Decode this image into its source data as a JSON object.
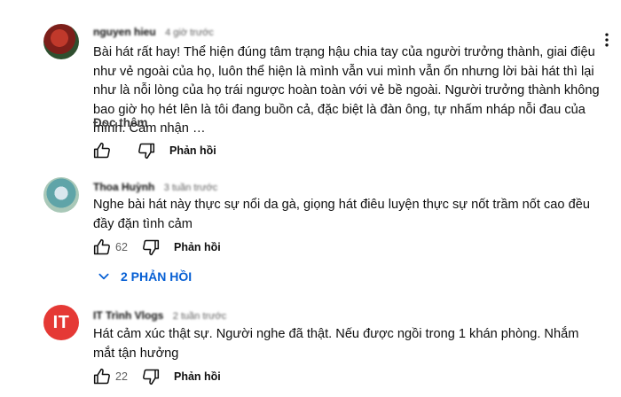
{
  "comments": [
    {
      "author": "nguyen hieu",
      "time": "4 giờ trước",
      "avatar_type": "photo",
      "text": "Bài hát rất hay! Thể hiện đúng tâm trạng hậu chia tay của người trưởng thành, giai điệu như vẻ ngoài của họ, luôn thể hiện là mình vẫn vui mình vẫn ổn nhưng lời bài hát thì lại như là nỗi lòng của họ trái ngược hoàn toàn với vẻ bề ngoài. Người trưởng thành không bao giờ họ hét lên là tôi đang buồn cả, đặc biệt là đàn ông, tự nhấm nháp nỗi đau của mình. Cảm nhận …",
      "read_more": "Đọc thêm",
      "like_count": "",
      "reply_label": "Phản hồi"
    },
    {
      "author": "Thoa Huỳnh",
      "time": "3 tuần trước",
      "avatar_type": "photo",
      "text": "Nghe bài hát này thực sự nổi da gà, giọng hát điêu luyện thực sự nốt trầm nốt cao đều đầy đặn tình cảm",
      "like_count": "62",
      "reply_label": "Phản hồi",
      "replies_toggle": "2 PHẢN HỒI"
    },
    {
      "author": "IT Trình Vlogs",
      "time": "2 tuần trước",
      "avatar_type": "initials",
      "avatar_initials": "IT",
      "text": "Hát cảm xúc thật sự. Người nghe đã thật. Nếu được ngồi trong 1 khán phòng. Nhắm mắt tận hưởng",
      "like_count": "22",
      "reply_label": "Phản hồi"
    }
  ],
  "colors": {
    "link_blue": "#065fd4",
    "avatar_red": "#e53935",
    "text_primary": "#0f0f0f",
    "text_secondary": "#606060"
  },
  "icons": {
    "like": "thumb-up-icon",
    "dislike": "thumb-down-icon",
    "menu": "more-vertical-icon",
    "expand": "chevron-down-icon"
  }
}
